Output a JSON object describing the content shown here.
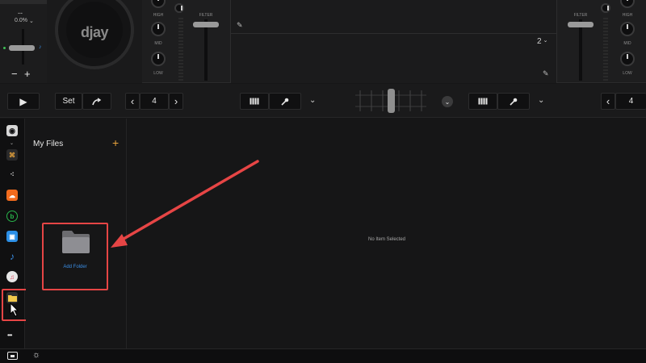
{
  "deck_left": {
    "pitch_dashes": "--",
    "pitch_percent": "0.0%",
    "pitch_chevron_glyph": "⌄",
    "minus_glyph": "−",
    "plus_glyph": "+",
    "logo_text": "djay"
  },
  "mixer": {
    "left_eq": {
      "high": "HIGH",
      "mid": "MID",
      "low": "LOW",
      "filter": "FILTER"
    },
    "right_eq": {
      "high": "HIGH",
      "mid": "MID",
      "low": "LOW",
      "filter": "FILTER"
    }
  },
  "deck_right": {
    "deck_number": "2",
    "chevron_glyph": "⌄"
  },
  "transport": {
    "play_glyph": "▶",
    "set_label": "Set",
    "loop_left_value": "4",
    "loop_right_value": "4",
    "prev_glyph": "‹",
    "next_glyph": "›",
    "chevron_glyph": "⌄"
  },
  "files_panel": {
    "title": "My Files",
    "add_glyph": "+",
    "add_folder_label": "Add Folder"
  },
  "detail": {
    "empty_text": "No Item Selected"
  },
  "sidebar": {
    "more_glyph": "•••"
  },
  "colors": {
    "accent_blue": "#3a8ee6",
    "highlight_red": "#e64545",
    "folder_yellow": "#f2c84b",
    "soundcloud_orange": "#f26b1d"
  }
}
